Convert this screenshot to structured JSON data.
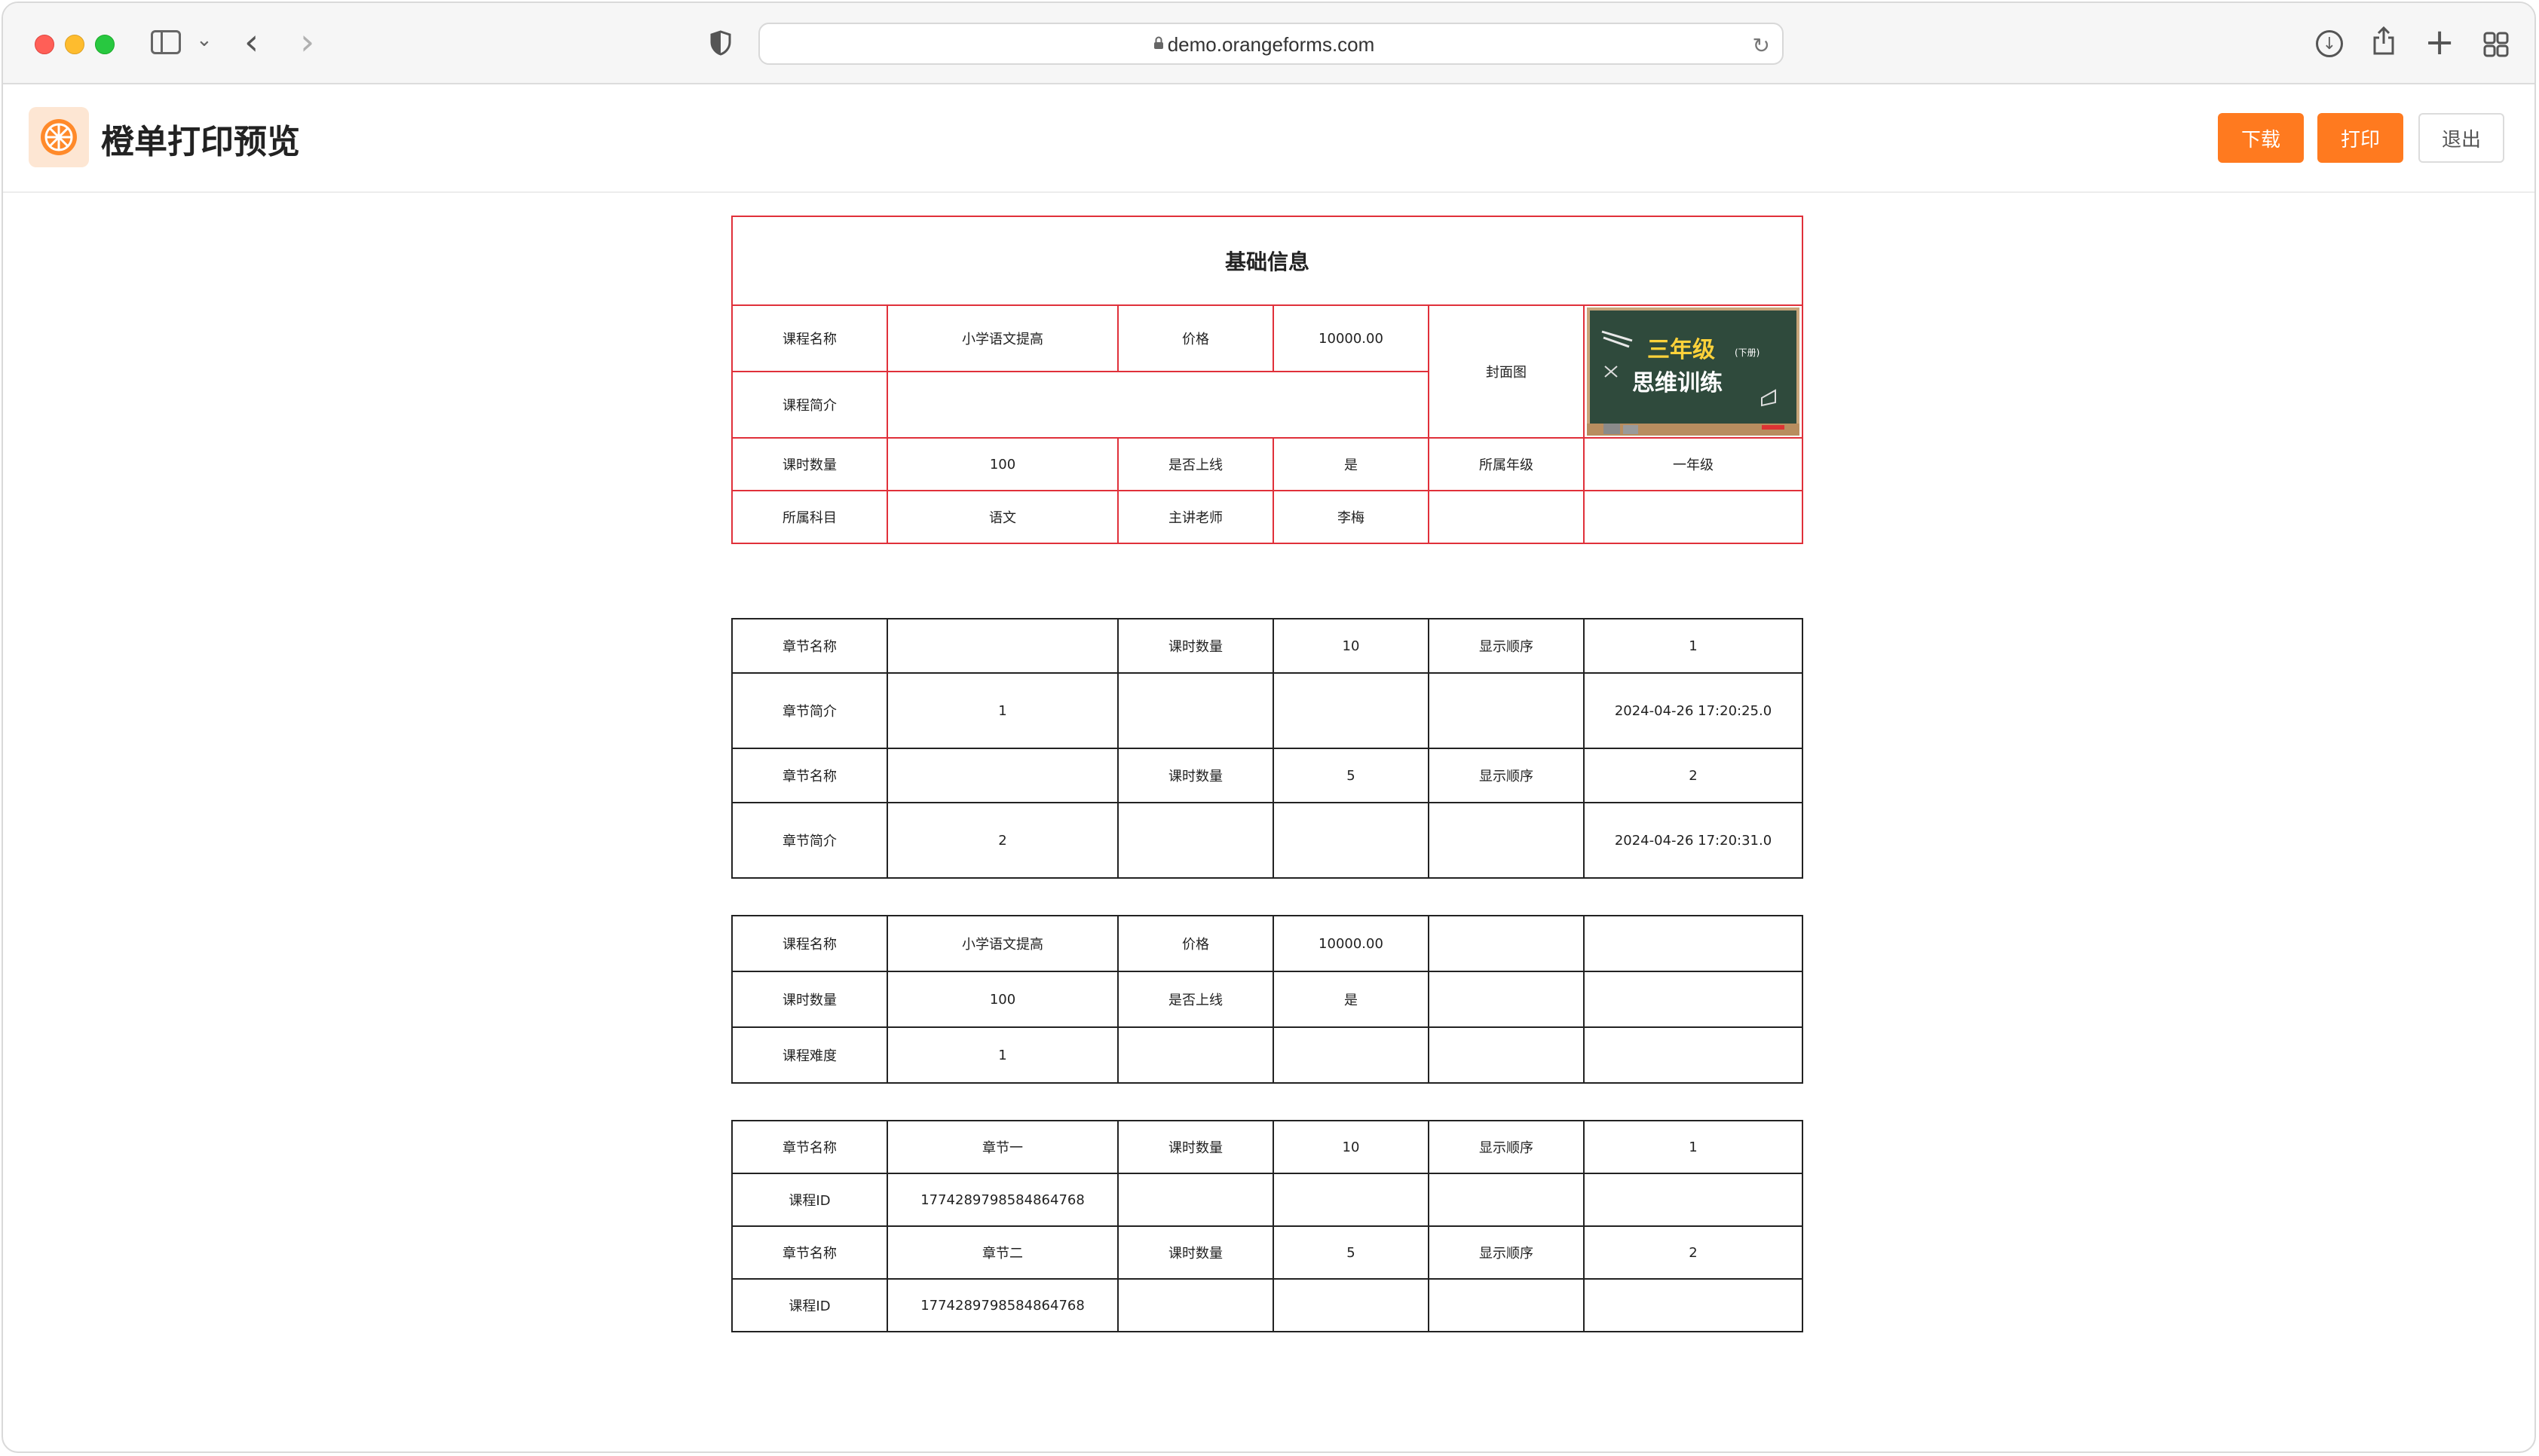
{
  "browser": {
    "url": "demo.orangeforms.com"
  },
  "header": {
    "title": "橙单打印预览",
    "buttons": {
      "download": "下载",
      "print": "打印",
      "exit": "退出"
    },
    "accent_color": "#ff7a1f"
  },
  "basic_info": {
    "title": "基础信息",
    "course_name_label": "课程名称",
    "course_name": "小学语文提高",
    "price_label": "价格",
    "price": "10000.00",
    "cover_label": "封面图",
    "cover_image": {
      "line1": "三年级",
      "line1_small": "(下册)",
      "line2": "思维训练"
    },
    "intro_label": "课程简介",
    "intro": "",
    "hours_label": "课时数量",
    "hours": "100",
    "online_label": "是否上线",
    "online": "是",
    "grade_label": "所属年级",
    "grade": "一年级",
    "subject_label": "所属科目",
    "subject": "语文",
    "teacher_label": "主讲老师",
    "teacher": "李梅",
    "border_color": "#e0303a"
  },
  "chapters_table": {
    "rows": [
      {
        "name_label": "章节名称",
        "name": "",
        "hours_label": "课时数量",
        "hours": "10",
        "order_label": "显示顺序",
        "order": "1",
        "intro_label": "章节简介",
        "intro": "1",
        "time": "2024-04-26 17:20:25.0"
      },
      {
        "name_label": "章节名称",
        "name": "",
        "hours_label": "课时数量",
        "hours": "5",
        "order_label": "显示顺序",
        "order": "2",
        "intro_label": "章节简介",
        "intro": "2",
        "time": "2024-04-26 17:20:31.0"
      }
    ]
  },
  "course_table": {
    "name_label": "课程名称",
    "name": "小学语文提高",
    "price_label": "价格",
    "price": "10000.00",
    "hours_label": "课时数量",
    "hours": "100",
    "online_label": "是否上线",
    "online": "是",
    "difficulty_label": "课程难度",
    "difficulty": "1"
  },
  "chapter_list_table": {
    "rows": [
      {
        "name_label": "章节名称",
        "name": "章节一",
        "hours_label": "课时数量",
        "hours": "10",
        "order_label": "显示顺序",
        "order": "1",
        "id_label": "课程ID",
        "course_id": "1774289798584864768"
      },
      {
        "name_label": "章节名称",
        "name": "章节二",
        "hours_label": "课时数量",
        "hours": "5",
        "order_label": "显示顺序",
        "order": "2",
        "id_label": "课程ID",
        "course_id": "1774289798584864768"
      }
    ]
  }
}
